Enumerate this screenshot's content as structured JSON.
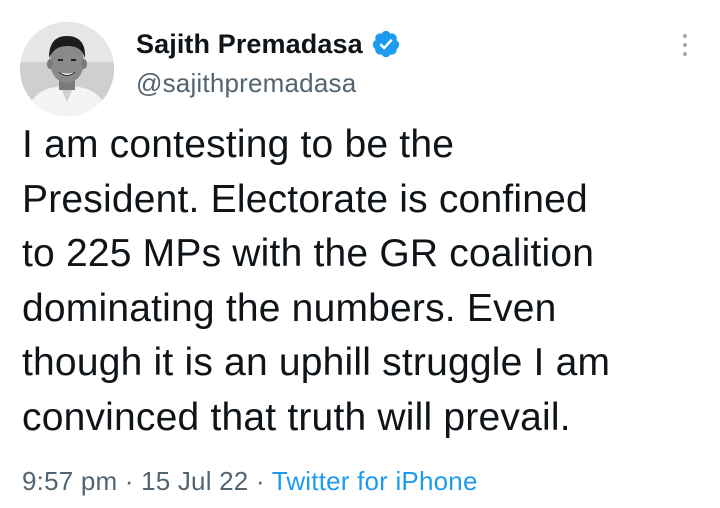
{
  "author": {
    "display_name": "Sajith Premadasa",
    "handle": "@sajithpremadasa",
    "verified": true,
    "avatar": "profile-photo"
  },
  "tweet": {
    "lines": [
      "I am contesting to be the",
      "President. Electorate is confined",
      "to 225 MPs with the GR coalition",
      "dominating the numbers. Even",
      "though it is an uphill struggle I am",
      "convinced that truth will prevail."
    ]
  },
  "meta": {
    "time": "9:57 pm",
    "separator": "·",
    "date": "15 Jul 22",
    "source": "Twitter for iPhone"
  },
  "icons": {
    "verified_badge": "verified-badge-icon",
    "more": "more-options-icon"
  },
  "colors": {
    "verified": "#1d9bf0",
    "link": "#1d9bf0",
    "secondary_text": "#536471"
  }
}
